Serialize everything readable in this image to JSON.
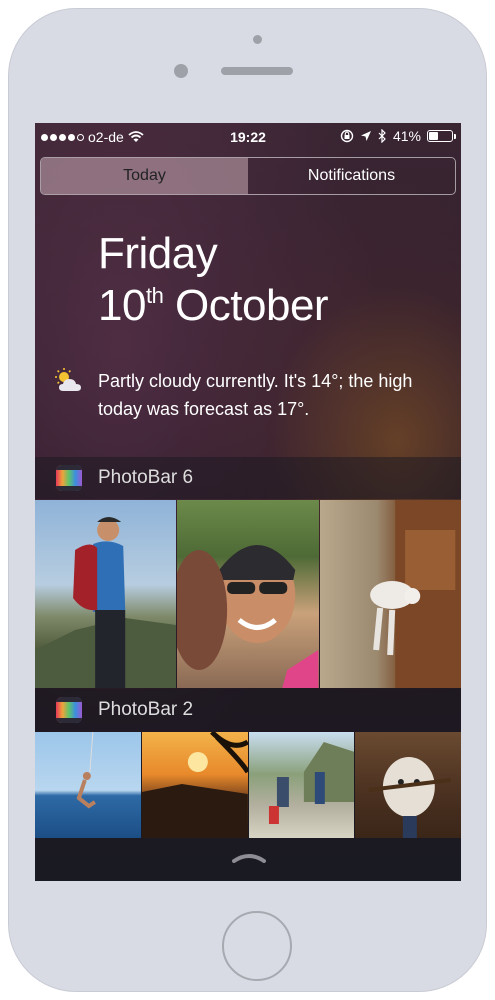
{
  "status_bar": {
    "carrier": "o2-de",
    "time": "19:22",
    "battery": "41%",
    "battery_level": 0.41,
    "icons": [
      "signal-dots",
      "wifi-icon",
      "rotation-lock-icon",
      "location-arrow-icon",
      "bluetooth-icon",
      "battery-icon"
    ]
  },
  "tabs": [
    {
      "label": "Today",
      "active": true
    },
    {
      "label": "Notifications",
      "active": false
    }
  ],
  "today": {
    "day": "Friday",
    "date_num": "10",
    "date_suffix": "th",
    "month": "October",
    "weather_icon": "partly-cloudy-icon",
    "weather_summary": "Partly cloudy currently. It's 14°; the high today was forecast as 17°."
  },
  "widgets": [
    {
      "title": "PhotoBar 6",
      "icon": "photobar-app-icon",
      "photo_count": 3
    },
    {
      "title": "PhotoBar 2",
      "icon": "photobar-app-icon",
      "photo_count": 4
    }
  ],
  "colors": {
    "accent": "#ffffff",
    "frame": "#d9dbe4",
    "segment_active": "#bfa0aa"
  }
}
